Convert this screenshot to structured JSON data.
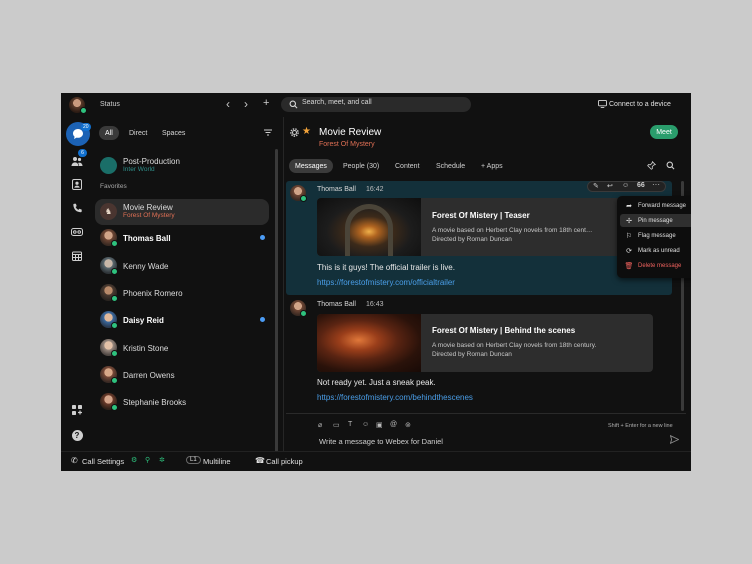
{
  "topbar": {
    "status_label": "Status",
    "search_placeholder": "Search, meet, and call",
    "connect_label": "Connect to a device"
  },
  "rail": {
    "messaging_badge": "20",
    "teams_badge": "6"
  },
  "list": {
    "filters": [
      "All",
      "Direct",
      "Spaces"
    ],
    "section_favorites": "Favorites",
    "items": [
      {
        "name": "Post-Production",
        "sub": "Inter World"
      },
      {
        "name": "Movie Review",
        "sub": "Forest Of Mystery"
      },
      {
        "name": "Thomas Ball"
      },
      {
        "name": "Kenny Wade"
      },
      {
        "name": "Phoenix Romero"
      },
      {
        "name": "Daisy Reid"
      },
      {
        "name": "Kristin Stone"
      },
      {
        "name": "Darren Owens"
      },
      {
        "name": "Stephanie Brooks"
      }
    ]
  },
  "conversation": {
    "title": "Movie Review",
    "subtitle": "Forest Of Mystery",
    "meet_label": "Meet",
    "tabs": [
      "Messages",
      "People (30)",
      "Content",
      "Schedule",
      "+ Apps"
    ],
    "messages": [
      {
        "author": "Thomas Ball",
        "time": "16:42",
        "card_title": "Forest Of Mistery | Teaser",
        "card_desc_1": "A movie based on Herbert Clay novels from 18th cent…",
        "card_desc_2": "Directed by Roman Duncan",
        "text": "This is it guys! The official trailer is live.",
        "link": "https://forestofmistery.com/officialtrailer"
      },
      {
        "author": "Thomas Ball",
        "time": "16:43",
        "card_title": "Forest Of Mistery | Behind the scenes",
        "card_desc_1": "A movie based on Herbert Clay novels from 18th century.",
        "card_desc_2": "Directed by Roman Duncan",
        "text": "Not ready yet. Just a sneak peak.",
        "link": "https://forestofmistery.com/behindthescenes"
      }
    ],
    "context_menu": [
      "Forward message",
      "Pin message",
      "Flag message",
      "Mark as unread",
      "Delete message"
    ],
    "composer_hint": "Shift + Enter for a new line",
    "composer_placeholder": "Write a message to Webex for Daniel"
  },
  "bottombar": {
    "call_settings": "Call Settings",
    "line_tag": "L1",
    "multiline": "Multiline",
    "call_pickup": "Call pickup"
  },
  "colors": {
    "accent_green": "#2a9d6c",
    "link_blue": "#4a9ee8",
    "subtitle_orange": "#e07055",
    "presence_green": "#2ec27e",
    "unread_blue": "#4b9cf5",
    "delete_red": "#f0625e"
  }
}
